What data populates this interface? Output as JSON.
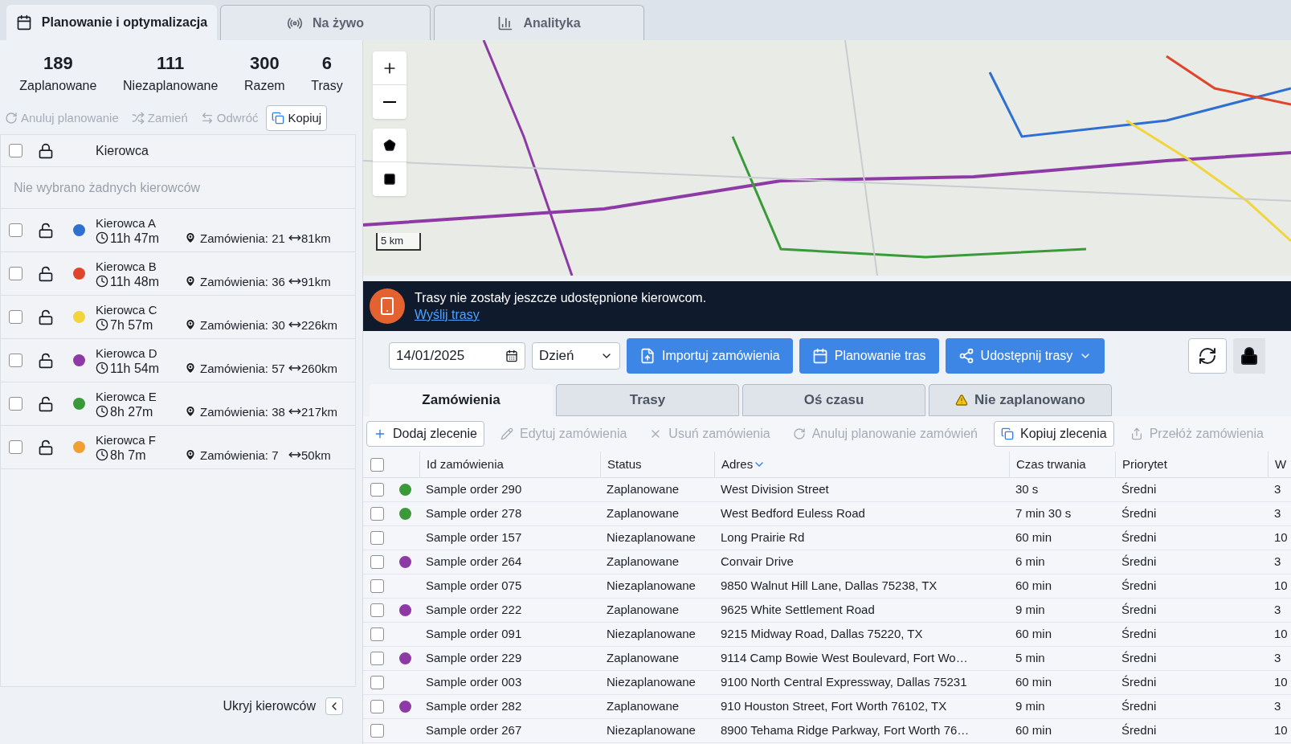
{
  "top_tabs": [
    {
      "label": "Planowanie i optymalizacja",
      "selected": true
    },
    {
      "label": "Na żywo",
      "selected": false
    },
    {
      "label": "Analityka",
      "selected": false
    }
  ],
  "stats": [
    {
      "value": "189",
      "label": "Zaplanowane"
    },
    {
      "value": "111",
      "label": "Niezaplanowane"
    },
    {
      "value": "300",
      "label": "Razem"
    },
    {
      "value": "6",
      "label": "Trasy"
    }
  ],
  "driver_actions": [
    {
      "label": "Anuluj planowanie",
      "disabled": true
    },
    {
      "label": "Zamień",
      "disabled": true
    },
    {
      "label": "Odwróć",
      "disabled": true
    },
    {
      "label": "Kopiuj",
      "disabled": false
    }
  ],
  "drivers_table": {
    "header": "Kierowca",
    "all_checked": false,
    "empty_note": "Nie wybrano żadnych kierowców",
    "rows": [
      {
        "name": "Kierowca A",
        "time": "11h 47m",
        "orders": "Zamówienia: 21",
        "distance": "81km",
        "color": "#2f6fd1",
        "checked": false
      },
      {
        "name": "Kierowca B",
        "time": "11h 48m",
        "orders": "Zamówienia: 36",
        "distance": "91km",
        "color": "#e0452b",
        "checked": false
      },
      {
        "name": "Kierowca C",
        "time": "7h 57m",
        "orders": "Zamówienia: 30",
        "distance": "226km",
        "color": "#f2d53c",
        "checked": false
      },
      {
        "name": "Kierowca D",
        "time": "11h 54m",
        "orders": "Zamówienia: 57",
        "distance": "260km",
        "color": "#8e3aa6",
        "checked": false
      },
      {
        "name": "Kierowca E",
        "time": "8h 27m",
        "orders": "Zamówienia: 38",
        "distance": "217km",
        "color": "#3a9a3a",
        "checked": false
      },
      {
        "name": "Kierowca F",
        "time": "8h 7m",
        "orders": "Zamówienia: 7",
        "distance": "50km",
        "color": "#f0a030",
        "checked": false
      }
    ]
  },
  "hide_drivers": "Ukryj kierowców",
  "map": {
    "scale": "5 km"
  },
  "banner": {
    "message": "Trasy nie zostały jeszcze udostępnione kierowcom.",
    "link": "Wyślij trasy"
  },
  "toolbar": {
    "date": "14/01/2025",
    "period": "Dzień",
    "buttons": [
      {
        "label": "Importuj zamówienia"
      },
      {
        "label": "Planowanie tras"
      },
      {
        "label": "Udostępnij trasy"
      }
    ]
  },
  "view_tabs": [
    {
      "label": "Zamówienia",
      "selected": true
    },
    {
      "label": "Trasy",
      "selected": false
    },
    {
      "label": "Oś czasu",
      "selected": false
    },
    {
      "label": "Nie zaplanowano",
      "selected": false
    }
  ],
  "order_actions": [
    {
      "label": "Dodaj zlecenie",
      "disabled": false
    },
    {
      "label": "Edytuj zamówienia",
      "disabled": true
    },
    {
      "label": "Usuń zamówienia",
      "disabled": true
    },
    {
      "label": "Anuluj planowanie zamówień",
      "disabled": true
    },
    {
      "label": "Kopiuj zlecenia",
      "disabled": false
    },
    {
      "label": "Przełóż zamówienia",
      "disabled": true
    }
  ],
  "orders_table": {
    "all_checked": false,
    "columns": [
      {
        "label": "Id zamówienia",
        "sorted": false
      },
      {
        "label": "Status",
        "sorted": false
      },
      {
        "label": "Adres",
        "sorted": true
      },
      {
        "label": "Czas trwania",
        "sorted": false
      },
      {
        "label": "Priorytet",
        "sorted": false
      },
      {
        "label": "W",
        "sorted": false
      }
    ],
    "rows": [
      {
        "id": "Sample order 290",
        "status": "Zaplanowane",
        "address": "West Division Street",
        "duration": "30 s",
        "priority": "Średni",
        "column_7": "3",
        "color": "#3a9a3a",
        "checked": false
      },
      {
        "id": "Sample order 278",
        "status": "Zaplanowane",
        "address": "West Bedford Euless Road",
        "duration": "7 min 30 s",
        "priority": "Średni",
        "column_7": "3",
        "color": "#3a9a3a",
        "checked": false
      },
      {
        "id": "Sample order 157",
        "status": "Niezaplanowane",
        "address": "Long Prairie Rd",
        "duration": "60 min",
        "priority": "Średni",
        "column_7": "10",
        "checked": false
      },
      {
        "id": "Sample order 264",
        "status": "Zaplanowane",
        "address": "Convair Drive",
        "duration": "6 min",
        "priority": "Średni",
        "column_7": "3",
        "color": "#8e3aa6",
        "checked": false
      },
      {
        "id": "Sample order 075",
        "status": "Niezaplanowane",
        "address": "9850 Walnut Hill Lane, Dallas 75238, TX",
        "duration": "60 min",
        "priority": "Średni",
        "column_7": "10",
        "checked": false
      },
      {
        "id": "Sample order 222",
        "status": "Zaplanowane",
        "address": "9625 White Settlement Road",
        "duration": "9 min",
        "priority": "Średni",
        "column_7": "3",
        "color": "#8e3aa6",
        "checked": false
      },
      {
        "id": "Sample order 091",
        "status": "Niezaplanowane",
        "address": "9215 Midway Road, Dallas 75220, TX",
        "duration": "60 min",
        "priority": "Średni",
        "column_7": "10",
        "checked": false
      },
      {
        "id": "Sample order 229",
        "status": "Zaplanowane",
        "address": "9114 Camp Bowie West Boulevard, Fort Wo…",
        "duration": "5 min",
        "priority": "Średni",
        "column_7": "3",
        "color": "#8e3aa6",
        "checked": false
      },
      {
        "id": "Sample order 003",
        "status": "Niezaplanowane",
        "address": "9100 North Central Expressway, Dallas 75231",
        "duration": "60 min",
        "priority": "Średni",
        "column_7": "10",
        "checked": false
      },
      {
        "id": "Sample order 282",
        "status": "Zaplanowane",
        "address": "910 Houston Street, Fort Worth 76102, TX",
        "duration": "9 min",
        "priority": "Średni",
        "column_7": "3",
        "color": "#8e3aa6",
        "checked": false
      },
      {
        "id": "Sample order 267",
        "status": "Niezaplanowane",
        "address": "8900 Tehama Ridge Parkway, Fort Worth 76…",
        "duration": "60 min",
        "priority": "Średni",
        "column_7": "10",
        "checked": false
      }
    ]
  }
}
